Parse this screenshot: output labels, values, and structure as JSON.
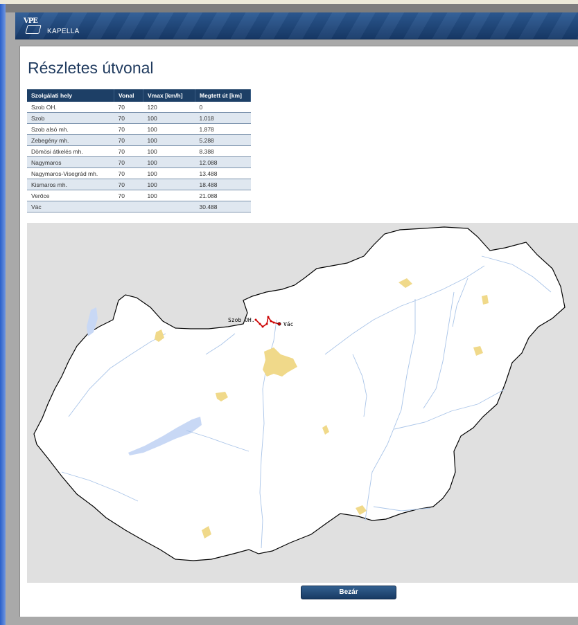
{
  "header": {
    "logo_text": "VPE",
    "brand": "KAPELLA"
  },
  "page": {
    "title": "Részletes útvonal"
  },
  "table": {
    "columns": [
      "Szolgálati hely",
      "Vonal",
      "Vmax [km/h]",
      "Megtett út [km]"
    ],
    "rows": [
      [
        "Szob OH.",
        "70",
        "120",
        "0"
      ],
      [
        "Szob",
        "70",
        "100",
        "1.018"
      ],
      [
        "Szob alsó mh.",
        "70",
        "100",
        "1.878"
      ],
      [
        "Zebegény mh.",
        "70",
        "100",
        "5.288"
      ],
      [
        "Dömösi átkelés mh.",
        "70",
        "100",
        "8.388"
      ],
      [
        "Nagymaros",
        "70",
        "100",
        "12.088"
      ],
      [
        "Nagymaros-Visegrád mh.",
        "70",
        "100",
        "13.488"
      ],
      [
        "Kismaros mh.",
        "70",
        "100",
        "18.488"
      ],
      [
        "Verőce",
        "70",
        "100",
        "21.088"
      ],
      [
        "Vác",
        "",
        "",
        "30.488"
      ]
    ]
  },
  "map": {
    "start_label": "Szob OH.",
    "end_label": "Vác",
    "route_color": "#cc0000",
    "city_color": "#f0d98a",
    "water_color": "#c8d8f5"
  },
  "buttons": {
    "close": "Bezár"
  }
}
